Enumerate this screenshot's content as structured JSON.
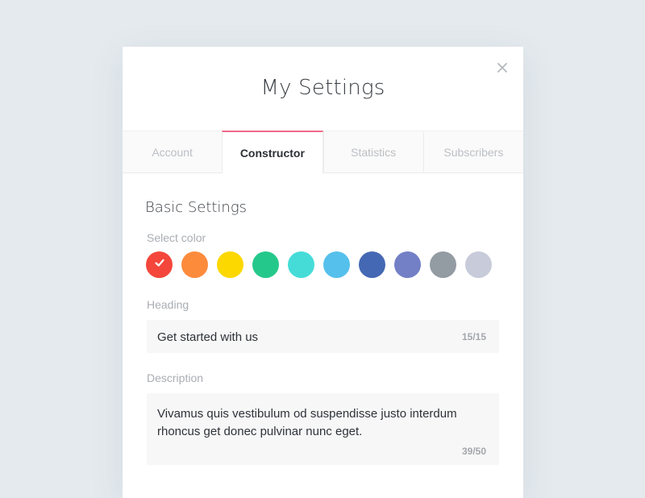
{
  "modal": {
    "title": "My Settings",
    "close_icon": "close-icon"
  },
  "tabs": [
    {
      "label": "Account",
      "active": false
    },
    {
      "label": "Constructor",
      "active": true
    },
    {
      "label": "Statistics",
      "active": false
    },
    {
      "label": "Subscribers",
      "active": false
    }
  ],
  "colors": {
    "accent": "#ef6a8a",
    "background": "#e4eaee"
  },
  "basic_settings": {
    "title": "Basic Settings",
    "select_color_label": "Select color",
    "swatches": [
      {
        "color": "#f4463b",
        "selected": true
      },
      {
        "color": "#fd8b3c",
        "selected": false
      },
      {
        "color": "#fcd800",
        "selected": false
      },
      {
        "color": "#25c88b",
        "selected": false
      },
      {
        "color": "#45dcd8",
        "selected": false
      },
      {
        "color": "#55c0ec",
        "selected": false
      },
      {
        "color": "#4468b3",
        "selected": false
      },
      {
        "color": "#7380c6",
        "selected": false
      },
      {
        "color": "#939ba3",
        "selected": false
      },
      {
        "color": "#c8cbda",
        "selected": false
      }
    ],
    "heading_label": "Heading",
    "heading_value": "Get started with us",
    "heading_counter": "15/15",
    "description_label": "Description",
    "description_value": "Vivamus quis vestibulum od suspendisse justo interdum rhoncus get donec pulvinar nunc eget.",
    "description_counter": "39/50"
  }
}
